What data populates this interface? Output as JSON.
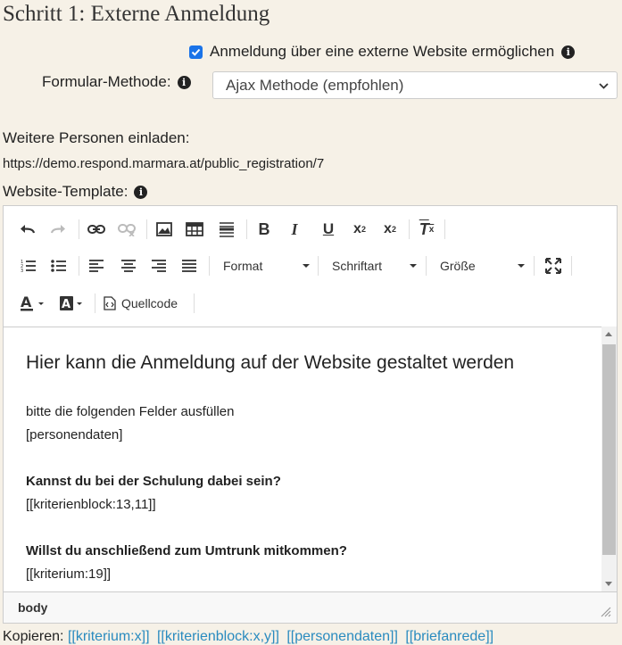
{
  "page": {
    "title": "Schritt 1: Externe Anmeldung",
    "external_checkbox": {
      "label": "Anmeldung über eine externe Website ermöglichen",
      "checked": true
    },
    "method": {
      "label": "Formular-Methode:",
      "value": "Ajax Methode (empfohlen)"
    },
    "invite": {
      "label": "Weitere Personen einladen:",
      "url": "https://demo.respond.marmara.at/public_registration/7"
    },
    "template_label": "Website-Template:"
  },
  "editor": {
    "toolbar": {
      "format_label": "Format",
      "font_label": "Schriftart",
      "size_label": "Größe",
      "source_label": "Quellcode",
      "icons": [
        "undo-icon",
        "redo-icon",
        "link-icon",
        "unlink-icon",
        "image-icon",
        "table-icon",
        "horizontal-rule-icon",
        "bold-icon",
        "italic-icon",
        "underline-icon",
        "subscript-icon",
        "superscript-icon",
        "remove-format-icon",
        "numbered-list-icon",
        "bulleted-list-icon",
        "align-left-icon",
        "align-center-icon",
        "align-right-icon",
        "align-justify-icon",
        "maximize-icon",
        "text-color-icon",
        "background-color-icon",
        "source-icon"
      ]
    },
    "content": {
      "heading": "Hier kann die Anmeldung auf der Website gestaltet werden",
      "line1": "bitte die folgenden Felder ausfüllen",
      "line2": "[personendaten]",
      "q1": "Kannst du bei der Schulung dabei sein?",
      "q1_code": "[[kriterienblock:13,11]]",
      "q2": "Willst du anschließend zum Umtrunk mitkommen?",
      "q2_code": "[[kriterium:19]]"
    },
    "status_path": "body"
  },
  "copy": {
    "label": "Kopieren:",
    "links": [
      "[[kriterium:x]]",
      "[[kriterienblock:x,y]]",
      "[[personendaten]]",
      "[[briefanrede]]"
    ]
  },
  "colors": {
    "background": "#f6f1e7",
    "checkbox": "#1a73e8",
    "link": "#2a8bbf"
  }
}
